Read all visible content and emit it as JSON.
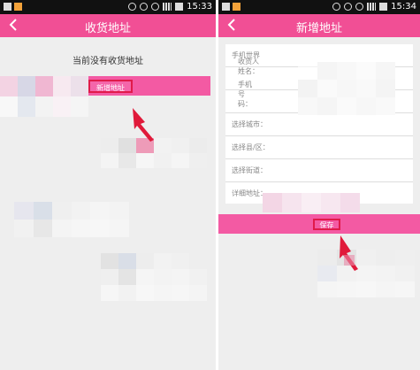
{
  "status_bar": {
    "time_left": "15:33",
    "time_right": "15:34"
  },
  "left_screen": {
    "title": "收货地址",
    "empty_message": "当前没有收货地址",
    "add_button": "新增地址"
  },
  "right_screen": {
    "title": "新增地址",
    "fields": [
      {
        "label": "收货人姓名：",
        "value": "手机世界"
      },
      {
        "label": "手机号码：",
        "value": ""
      },
      {
        "label": "",
        "value": ""
      },
      {
        "label": "选择城市：",
        "value": ""
      },
      {
        "label": "选择县/区：",
        "value": ""
      },
      {
        "label": "选择街道：",
        "value": ""
      },
      {
        "label": "详细地址：",
        "value": ""
      }
    ],
    "save_button": "保存"
  },
  "colors": {
    "accent": "#f14f95",
    "highlight_red": "#e01a4a",
    "background": "#eeeeee"
  }
}
